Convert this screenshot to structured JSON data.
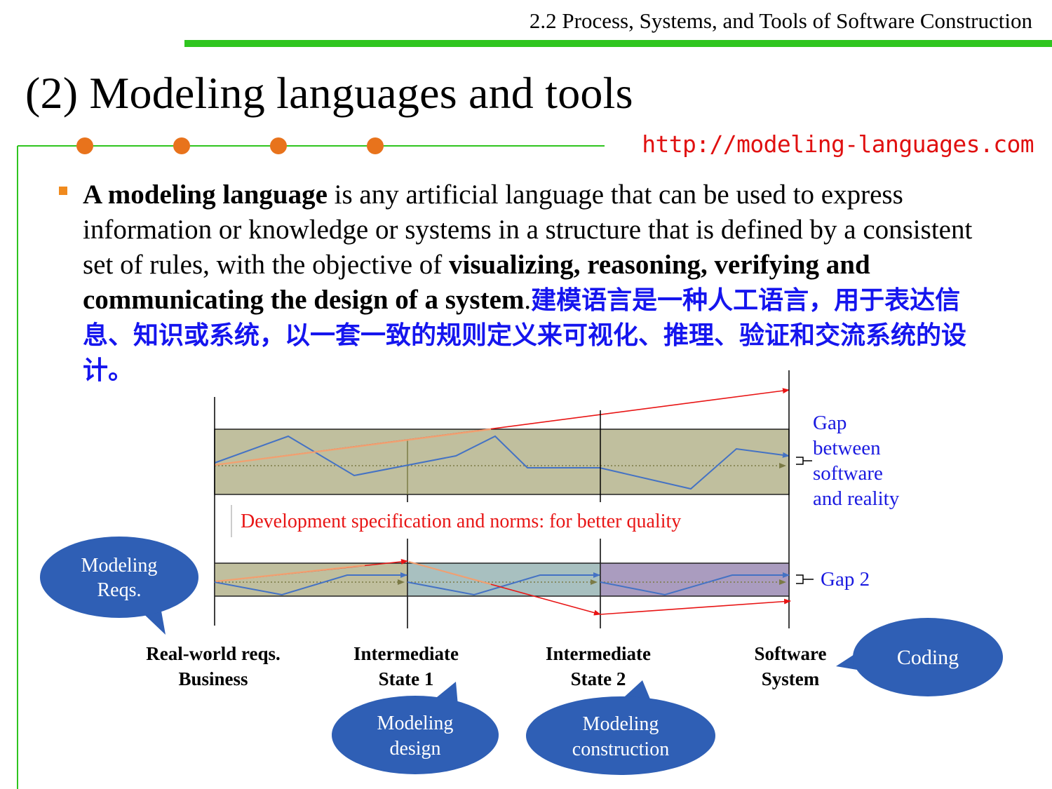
{
  "header": {
    "title": "2.2 Process, Systems, and Tools of Software Construction",
    "rule_color": "#2fc51f"
  },
  "slide": {
    "title": "(2) Modeling languages and tools",
    "url": "http://modeling-languages.com"
  },
  "bullet": {
    "term": "A modeling language",
    "text1": " is any artificial language that can be used to express information or knowledge or systems in a structure that is defined by a consistent set of rules, with the objective of ",
    "emphasis": "visualizing, reasoning, verifying and communicating the design of a system",
    "text2": ".",
    "chinese": "建模语言是一种人工语言，用于表达信息、知识或系统，以一套一致的规则定义来可视化、推理、验证和交流系统的设计。"
  },
  "diagram": {
    "gap1_label": [
      "Gap",
      "between",
      "software",
      "and reality"
    ],
    "gap2_label": "Gap 2",
    "norms_label": "Development specification and norms: for better quality",
    "stages": [
      {
        "line1": "Real-world reqs.",
        "line2": "Business"
      },
      {
        "line1": "Intermediate",
        "line2": "State 1"
      },
      {
        "line1": "Intermediate",
        "line2": "State 2"
      },
      {
        "line1": "Software",
        "line2": "System"
      }
    ],
    "bubbles": {
      "modeling_reqs": [
        "Modeling",
        "Reqs."
      ],
      "modeling_design": [
        "Modeling",
        "design"
      ],
      "modeling_construction": [
        "Modeling",
        "construction"
      ],
      "coding": [
        "Coding"
      ]
    },
    "colors": {
      "band_olive": "#c0bf9e",
      "band_teal": "#a8c0c0",
      "band_purple": "#aa9cbf",
      "line_blue": "#4472c4",
      "arrow_red": "#e81515",
      "bubble_blue": "#2f5fb5"
    }
  }
}
